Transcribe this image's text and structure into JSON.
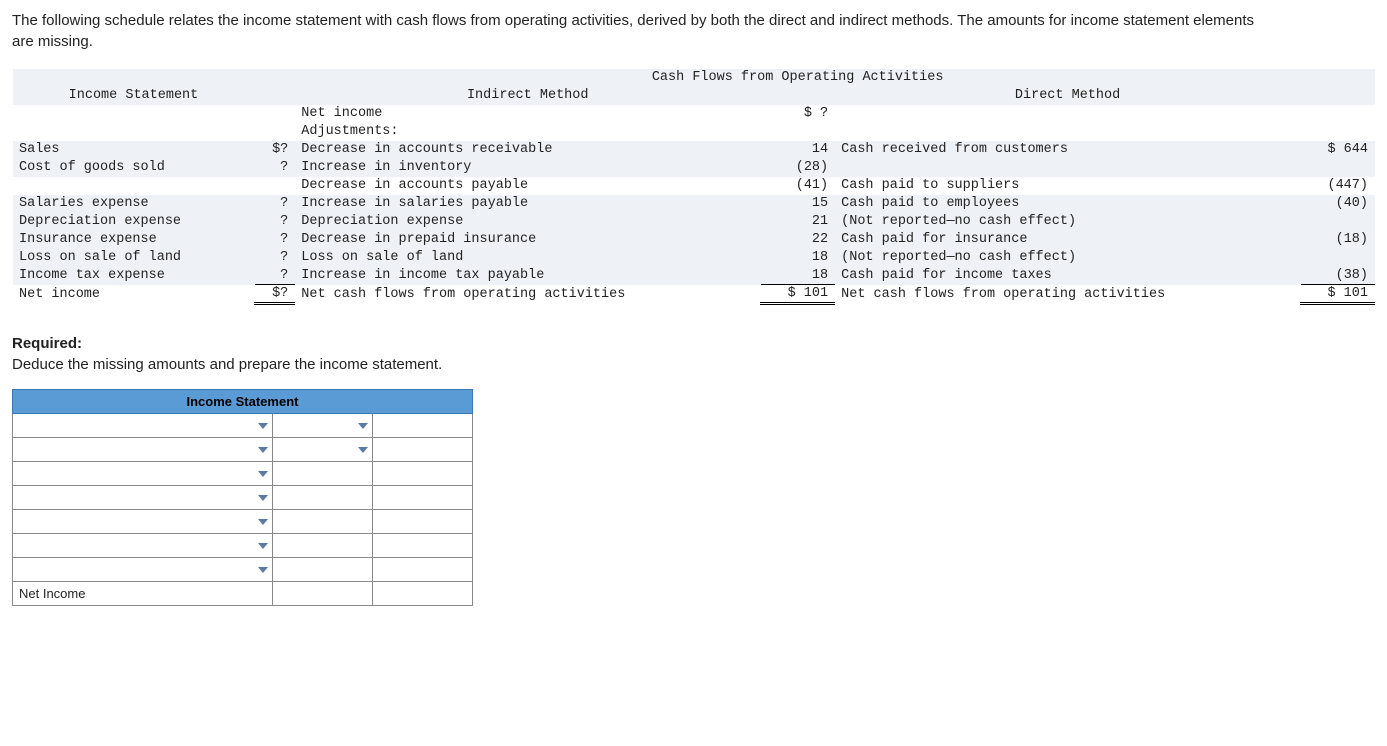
{
  "intro": "The following schedule relates the income statement with cash flows from operating activities, derived by both the direct and indirect methods. The amounts for income statement elements are missing.",
  "headers": {
    "income_statement": "Income Statement",
    "cash_flows_title": "Cash Flows from Operating Activities",
    "indirect": "Indirect Method",
    "direct": "Direct Method"
  },
  "left": {
    "sales": "Sales",
    "cogs": "Cost of goods sold",
    "salaries": "Salaries expense",
    "depr": "Depreciation expense",
    "ins": "Insurance expense",
    "loss": "Loss on sale of land",
    "tax": "Income tax expense",
    "net": "Net income"
  },
  "left_vals": {
    "sales": "$?",
    "cogs": "?",
    "salaries": "?",
    "depr": "?",
    "ins": "?",
    "loss": "?",
    "tax": "?",
    "net": "$?"
  },
  "indirect": {
    "net_income": "Net income",
    "adjustments": "Adjustments:",
    "dec_ar": "Decrease in accounts receivable",
    "inc_inv": "Increase in inventory",
    "dec_ap": "Decrease in accounts payable",
    "inc_sal_pay": "Increase in salaries payable",
    "depr": "Depreciation expense",
    "dec_prepaid": "Decrease in prepaid insurance",
    "loss": "Loss on sale of land",
    "inc_tax_pay": "Increase in income tax payable",
    "net_cash": "Net cash flows from operating activities"
  },
  "indirect_vals": {
    "net_income": "$  ?",
    "dec_ar": "14",
    "inc_inv": "(28)",
    "dec_ap": "(41)",
    "inc_sal_pay": "15",
    "depr": "21",
    "dec_prepaid": "22",
    "loss": "18",
    "inc_tax_pay": "18",
    "net_cash": "$ 101"
  },
  "direct": {
    "cash_cust": "Cash received from customers",
    "cash_supp": "Cash paid to suppliers",
    "cash_emp": "Cash paid to employees",
    "no_report1": "(Not reported—no cash effect)",
    "cash_ins": "Cash paid for insurance",
    "no_report2": "(Not reported—no cash effect)",
    "cash_tax": "Cash paid for income taxes",
    "net_cash": "Net cash flows from operating activities"
  },
  "direct_vals": {
    "cash_cust": "$ 644",
    "cash_supp": "(447)",
    "cash_emp": "(40)",
    "cash_ins": "(18)",
    "cash_tax": "(38)",
    "net_cash": "$ 101"
  },
  "required": {
    "label": "Required:",
    "text": "Deduce the missing amounts and prepare the income statement."
  },
  "answer_table": {
    "header": "Income Statement",
    "net_income_label": "Net Income"
  }
}
